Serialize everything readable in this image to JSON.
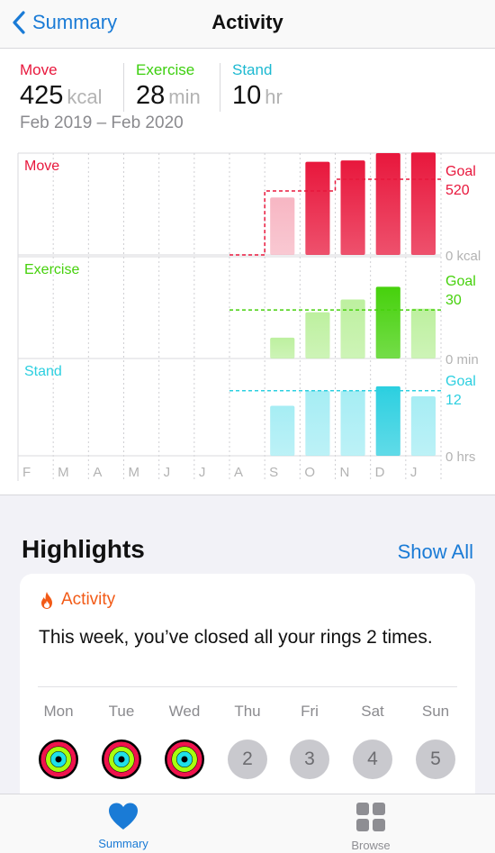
{
  "nav": {
    "back_label": "Summary",
    "title": "Activity"
  },
  "stats": {
    "move": {
      "label": "Move",
      "value": "425",
      "unit": "kcal",
      "color": "#e8173c"
    },
    "exercise": {
      "label": "Exercise",
      "value": "28",
      "unit": "min",
      "color": "#3ccf0e"
    },
    "stand": {
      "label": "Stand",
      "value": "10",
      "unit": "hr",
      "color": "#1cb9d1"
    },
    "date_range": "Feb 2019 – Feb 2020"
  },
  "chart_data": {
    "type": "bar",
    "categories": [
      "F",
      "M",
      "A",
      "M",
      "J",
      "J",
      "A",
      "S",
      "O",
      "N",
      "D",
      "J"
    ],
    "series": [
      {
        "name": "Move",
        "unit_label": "0 kcal",
        "goal_label": "Goal",
        "goal_value_label": "520",
        "goal": 520,
        "ymax": 700,
        "values": [
          null,
          null,
          null,
          null,
          null,
          null,
          null,
          395,
          640,
          650,
          700,
          705
        ],
        "goal_steps": [
          null,
          null,
          null,
          null,
          null,
          null,
          0,
          440,
          440,
          520,
          520,
          520
        ],
        "color": "#e8173c",
        "light_color": "#f7b6c3"
      },
      {
        "name": "Exercise",
        "unit_label": "0 min",
        "goal_label": "Goal",
        "goal_value_label": "30",
        "goal": 30,
        "ymax": 44,
        "values": [
          null,
          null,
          null,
          null,
          null,
          null,
          null,
          9,
          20,
          25.5,
          31,
          21.5
        ],
        "goal_steps": [
          null,
          null,
          null,
          null,
          null,
          null,
          21,
          21,
          21,
          21,
          21,
          21
        ],
        "color": "#46d10c",
        "light_color": "#bdf09f"
      },
      {
        "name": "Stand",
        "unit_label": "0 hrs",
        "goal_label": "Goal",
        "goal_value_label": "12",
        "goal": 12,
        "ymax": 17.5,
        "values": [
          null,
          null,
          null,
          null,
          null,
          null,
          null,
          9,
          11.7,
          11.7,
          12.5,
          10.7
        ],
        "goal_steps": [
          null,
          null,
          null,
          null,
          null,
          null,
          11.7,
          11.7,
          11.7,
          11.7,
          11.7,
          11.7
        ],
        "color": "#2ccfe0",
        "light_color": "#a6edf4"
      }
    ]
  },
  "highlights": {
    "heading": "Highlights",
    "show_all": "Show All",
    "card_title": "Activity",
    "card_text": "This week, you’ve closed all your rings 2 times.",
    "days": [
      {
        "label": "Mon",
        "closed": true
      },
      {
        "label": "Tue",
        "closed": true
      },
      {
        "label": "Wed",
        "closed": true
      },
      {
        "label": "Thu",
        "closed": false,
        "number": "2"
      },
      {
        "label": "Fri",
        "closed": false,
        "number": "3"
      },
      {
        "label": "Sat",
        "closed": false,
        "number": "4"
      },
      {
        "label": "Sun",
        "closed": false,
        "number": "5"
      }
    ]
  },
  "tabbar": {
    "summary_label": "Summary",
    "browse_label": "Browse",
    "active_color": "#1a7bd6",
    "inactive_color": "#8e8e93"
  }
}
